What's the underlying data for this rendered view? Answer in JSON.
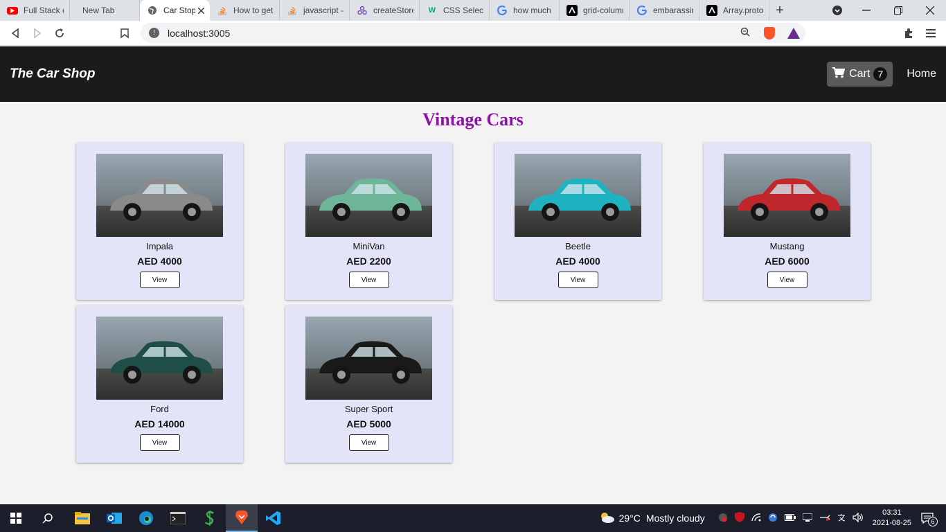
{
  "browser": {
    "tabs": [
      {
        "label": "Full Stack eC",
        "icon": "youtube-icon",
        "color": "#ff0000"
      },
      {
        "label": "New Tab",
        "icon": "none",
        "color": "#dee1e6"
      },
      {
        "label": "Car Stop",
        "icon": "globe-icon",
        "color": "#5f6368",
        "active": true
      },
      {
        "label": "How to get",
        "icon": "stackoverflow-icon",
        "color": "#f48024"
      },
      {
        "label": "javascript -",
        "icon": "stackoverflow-icon",
        "color": "#f48024"
      },
      {
        "label": "createStore",
        "icon": "redux-icon",
        "color": "#764abc"
      },
      {
        "label": "CSS Selecto",
        "icon": "w3schools-icon",
        "color": "#04aa6d"
      },
      {
        "label": "how much c",
        "icon": "google-icon",
        "color": "#4285f4"
      },
      {
        "label": "grid-column",
        "icon": "mdn-icon",
        "color": "#000000"
      },
      {
        "label": "embarassing",
        "icon": "google-icon",
        "color": "#4285f4"
      },
      {
        "label": "Array.proto",
        "icon": "mdn-icon",
        "color": "#000000"
      }
    ],
    "new_tab": "+",
    "address": "localhost:3005"
  },
  "site": {
    "brand": "The Car Shop",
    "cart_label": "Cart",
    "cart_count": "7",
    "home_label": "Home",
    "heading": "Vintage Cars",
    "view_label": "View",
    "cars": [
      {
        "name": "Impala",
        "price": "AED 4000",
        "color": "#8a8a8a"
      },
      {
        "name": "MiniVan",
        "price": "AED 2200",
        "color": "#6fb59a"
      },
      {
        "name": "Beetle",
        "price": "AED 4000",
        "color": "#1fb3c2"
      },
      {
        "name": "Mustang",
        "price": "AED 6000",
        "color": "#c0272d"
      },
      {
        "name": "Ford",
        "price": "AED 14000",
        "color": "#1f4d48"
      },
      {
        "name": "Super Sport",
        "price": "AED 5000",
        "color": "#1a1a1a"
      }
    ]
  },
  "taskbar": {
    "weather_temp": "29°C",
    "weather_text": "Mostly cloudy",
    "time": "03:31",
    "date": "2021-08-25",
    "notifications": "6"
  }
}
